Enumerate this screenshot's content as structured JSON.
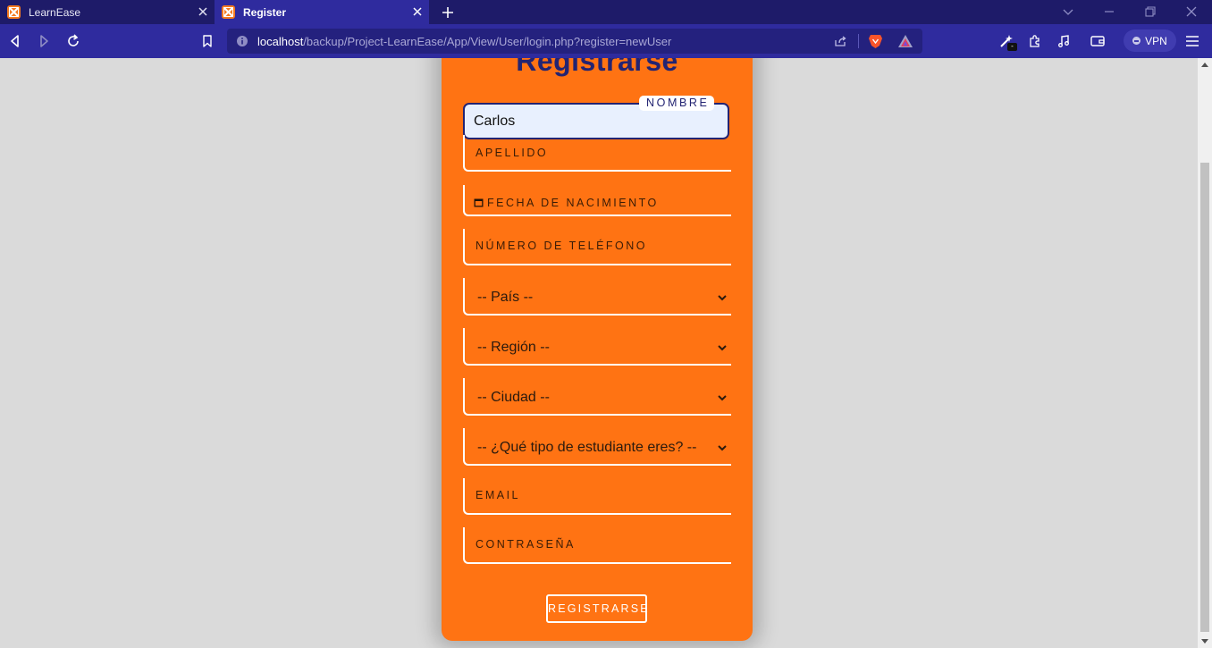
{
  "browser": {
    "tabs": [
      {
        "title": "LearnEase",
        "active": false
      },
      {
        "title": "Register",
        "active": true
      }
    ],
    "url": {
      "host": "localhost",
      "path": "/backup/Project-LearnEase/App/View/User/login.php?register=newUser"
    },
    "vpn_label": "VPN"
  },
  "form": {
    "title": "Registrarse",
    "nombre": {
      "label": "NOMBRE",
      "value": "Carlos"
    },
    "apellido": {
      "label": "APELLIDO"
    },
    "fecha": {
      "label": "FECHA DE NACIMIENTO"
    },
    "telefono": {
      "label": "NÚMERO DE TELÉFONO"
    },
    "pais": {
      "selected": "-- País --"
    },
    "region": {
      "selected": "-- Región --"
    },
    "ciudad": {
      "selected": "-- Ciudad --"
    },
    "tipo": {
      "selected": "-- ¿Qué tipo de estudiante eres? --"
    },
    "email": {
      "label": "EMAIL"
    },
    "contrasena": {
      "label": "CONTRASEÑA"
    },
    "submit_label": "REGISTRARSE"
  },
  "colors": {
    "accent_orange": "#ff7313",
    "navy": "#232472",
    "tabbar": "#1e1b69",
    "toolbar": "#2f2b9e"
  },
  "icons": [
    "xampp-icon",
    "close-icon",
    "plus-icon",
    "back-icon",
    "forward-icon",
    "reload-icon",
    "bookmark-icon",
    "info-icon",
    "share-icon",
    "brave-shield-icon",
    "brave-rewards-icon",
    "wand-icon",
    "extensions-icon",
    "music-icon",
    "wallet-icon",
    "menu-icon",
    "calendar-icon",
    "chevron-down-icon"
  ]
}
